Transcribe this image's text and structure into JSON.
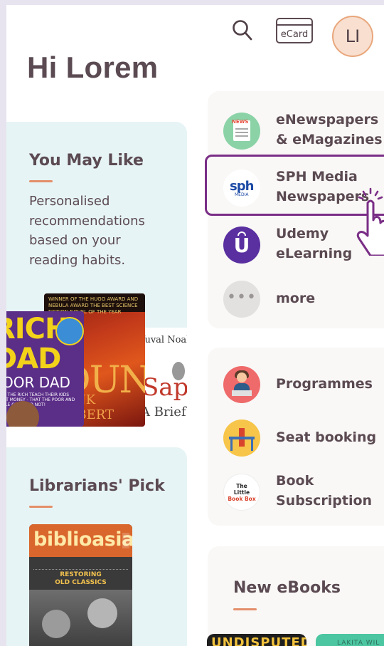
{
  "header": {
    "greeting": "Hi Lorem",
    "ecard_label": "eCard",
    "avatar_initials": "LI",
    "search_icon": "search-icon"
  },
  "you_may_like": {
    "title": "You May Like",
    "description": "Personalised recommendations based on your reading habits.",
    "books": [
      {
        "cover_text": [
          "RICH",
          "DAD",
          "POOR DAD"
        ],
        "subtitle": "WHAT THE RICH TEACH THEIR KIDS ABOUT MONEY - THAT THE POOR AND MIDDLE CLASS DO NOT!"
      },
      {
        "cover_text": "DUNE",
        "tagline": "WINNER OF THE HUGO AWARD AND NEBULA AWARD THE BEST SCIENCE FICTION NOVEL OF THE YEAR",
        "author": "FRANK HERBERT"
      },
      {
        "cover_text": "Sapiens",
        "author": "Yuval Noah Harari",
        "subtitle": "A Brief"
      }
    ]
  },
  "librarians_pick": {
    "title": "Librarians' Pick",
    "book": {
      "masthead": "biblioasia",
      "headline": [
        "RESTORING",
        "OLD CLASSICS"
      ]
    }
  },
  "services": [
    {
      "label": "eNewspapers & eMagazines",
      "icon": "newspaper-icon",
      "icon_tag": "NEWS"
    },
    {
      "label": "SPH Media Newspapers",
      "icon": "sph-media-icon",
      "icon_text": "sph",
      "icon_sub": "MEDIA"
    },
    {
      "label": "Udemy eLearning",
      "icon": "udemy-icon",
      "icon_text": "U"
    },
    {
      "label": "more",
      "icon": "more-icon",
      "icon_text": "•••"
    }
  ],
  "activities": [
    {
      "label": "Programmes",
      "icon": "programmes-icon"
    },
    {
      "label": "Seat booking",
      "icon": "seat-booking-icon"
    },
    {
      "label": "Book Subscription",
      "icon": "book-box-icon",
      "icon_text": [
        "The",
        "Little",
        "Book Box"
      ]
    }
  ],
  "new_ebooks": {
    "title": "New eBooks",
    "thumbs": [
      {
        "text": "UNDISPUTED"
      },
      {
        "text": "LAKITA WIL"
      }
    ]
  },
  "colors": {
    "text": "#5b4a52",
    "accent": "#e48f6a",
    "highlight": "#7a2e86",
    "card_bg": "#e7f4f5",
    "panel_bg": "#f9f8f6"
  }
}
